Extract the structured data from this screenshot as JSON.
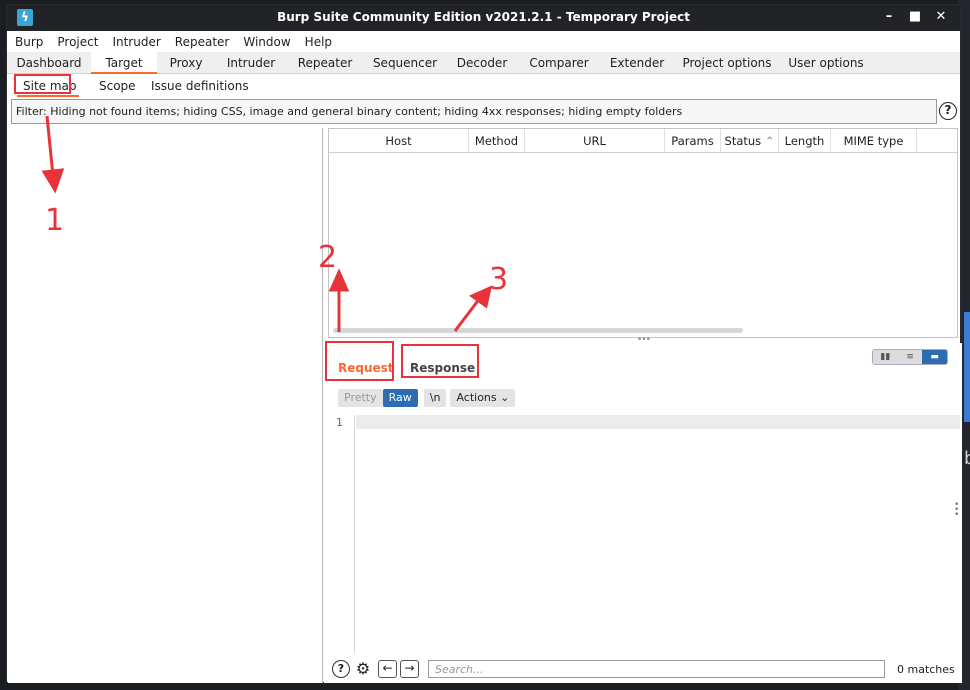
{
  "window": {
    "title": "Burp Suite Community Edition v2021.2.1 - Temporary Project",
    "icon_label": "ϟ",
    "minimize": "–",
    "maximize": "■",
    "close": "✕"
  },
  "menu": [
    "Burp",
    "Project",
    "Intruder",
    "Repeater",
    "Window",
    "Help"
  ],
  "main_tabs": [
    "Dashboard",
    "Target",
    "Proxy",
    "Intruder",
    "Repeater",
    "Sequencer",
    "Decoder",
    "Comparer",
    "Extender",
    "Project options",
    "User options"
  ],
  "active_main_tab": "Target",
  "sub_tabs": [
    "Site map",
    "Scope",
    "Issue definitions"
  ],
  "active_sub_tab": "Site map",
  "filter": {
    "text": "Filter: Hiding not found items;  hiding CSS, image and general binary content;  hiding 4xx responses;  hiding empty folders",
    "help": "?"
  },
  "table": {
    "columns": [
      "Host",
      "Method",
      "URL",
      "Params",
      "Status",
      "Length",
      "MIME type"
    ],
    "sort_indicator": "⌃"
  },
  "editor": {
    "tabs": [
      "Request",
      "Response"
    ],
    "active_tab": "Request",
    "view_toggle": [
      "▮▮",
      "≡",
      "▬"
    ],
    "buttons": {
      "pretty": "Pretty",
      "raw": "Raw",
      "newline": "\\n",
      "actions": "Actions ⌄"
    },
    "line_number": "1"
  },
  "bottom": {
    "help": "?",
    "settings": "⚙",
    "prev": "←",
    "next": "→",
    "search_placeholder": "Search...",
    "matches": "0 matches"
  },
  "annotations": {
    "labels": [
      "1",
      "2",
      "3"
    ],
    "color": "#e8333a"
  },
  "desktop": {
    "letter": "b"
  }
}
